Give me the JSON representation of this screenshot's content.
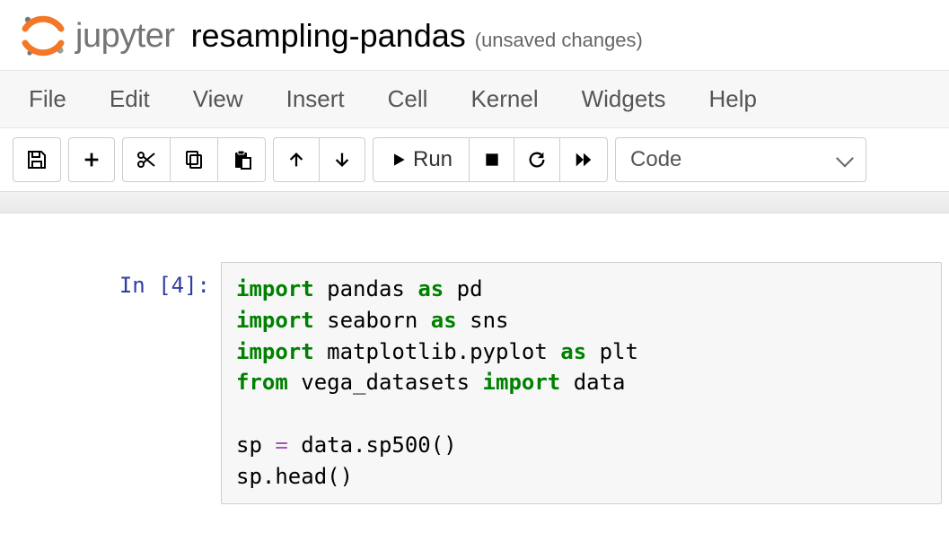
{
  "header": {
    "brand": "jupyter",
    "title": "resampling-pandas",
    "status": "(unsaved changes)"
  },
  "menubar": {
    "items": [
      "File",
      "Edit",
      "View",
      "Insert",
      "Cell",
      "Kernel",
      "Widgets",
      "Help"
    ]
  },
  "toolbar": {
    "run_label": "Run",
    "select_value": "Code"
  },
  "cell": {
    "prompt": "In [4]:",
    "code": {
      "lines": [
        {
          "t": "import_as",
          "mod": "pandas",
          "alias": "pd"
        },
        {
          "t": "import_as",
          "mod": "seaborn",
          "alias": "sns"
        },
        {
          "t": "import_as",
          "mod": "matplotlib.pyplot",
          "alias": "plt"
        },
        {
          "t": "from_import",
          "mod": "vega_datasets",
          "name": "data"
        },
        {
          "t": "blank"
        },
        {
          "t": "plain",
          "text": "sp = data.sp500()"
        },
        {
          "t": "plain",
          "text": "sp.head()"
        }
      ]
    }
  }
}
